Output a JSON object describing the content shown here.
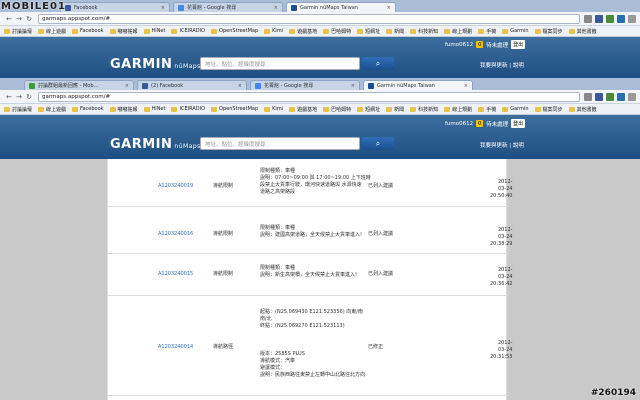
{
  "watermark": {
    "brand": "MOBILE01",
    "post_id": "#260194"
  },
  "browser_back": {
    "tabs": [
      {
        "label": "Facebook",
        "color": "#3b5998"
      },
      {
        "label": "花菁館 - Google 搜尋",
        "color": "#4285f4"
      },
      {
        "label": "Garmin nüMaps Taiwan",
        "color": "#1a4f8f"
      }
    ],
    "url": "garmaps.appspot.com/#",
    "bookmarks": [
      "討論論壇",
      "線上遊戲",
      "Facebook",
      "嘟嘟搖報",
      "HiNet",
      "ICEIRADIO",
      "OpenStreetMap",
      "Kimi",
      "遊戲基地",
      "巴哈姆特",
      "短網址",
      "新聞",
      "科技新知",
      "線上規劃",
      "手機",
      "Garmin",
      "檔案同步",
      "其他書籤"
    ]
  },
  "garmin_back": {
    "user": "fumo0612",
    "badge": "0",
    "signal": "待未處理",
    "logout": "登出",
    "logo": "GARMIN",
    "logo_sub": "nüMaps",
    "search_placeholder": "地址、點位、經緯度搜尋",
    "search_icon": "magnifier-icon",
    "links": "我要與更新 | 說明"
  },
  "browser_front": {
    "tabs": [
      {
        "label": "討論群組最新回應 - Mob…",
        "color": "#3a9d3a"
      },
      {
        "label": "(2) Facebook",
        "color": "#3b5998"
      },
      {
        "label": "花菁館 - Google 搜尋",
        "color": "#4285f4"
      },
      {
        "label": "Garmin nüMaps Taiwan",
        "color": "#1a4f8f"
      }
    ],
    "url": "garmaps.appspot.com/#",
    "bookmarks": [
      "討論論壇",
      "線上遊戲",
      "Facebook",
      "嘟嘟搖報",
      "HiNet",
      "ICEIRADIO",
      "OpenStreetMap",
      "Kimi",
      "遊戲基地",
      "巴哈姆特",
      "短網址",
      "新聞",
      "科技新知",
      "線上規劃",
      "手機",
      "Garmin",
      "檔案同步",
      "其他書籤"
    ]
  },
  "garmin_front": {
    "user": "fumo0612",
    "badge": "0",
    "signal": "待未處理",
    "logout": "登出",
    "logo": "GARMIN",
    "logo_sub": "nüMaps",
    "search_placeholder": "地址、點位、經緯度搜尋",
    "links": "我要與更新 | 說明"
  },
  "records": [
    {
      "id": "A1203240019",
      "type": "導航限制",
      "detail": [
        "限制種類：車種",
        "說明：07:00~09:00 與 17:00~19:00 上下班時",
        "段禁止大貨車行駛，環河快速道路與 水源快速",
        "道路之高架路段"
      ],
      "status": "已列入建議",
      "date": "2012-03-24",
      "time": "20:50:40"
    },
    {
      "id": "A1203240016",
      "type": "導航限制",
      "detail": [
        "限制種類：車種",
        "說明：建國高架道路，全天候禁止大貨車進入!"
      ],
      "status": "已列入建議",
      "date": "2012-03-24",
      "time": "20:38:29"
    },
    {
      "id": "A1203240015",
      "type": "導航限制",
      "detail": [
        "限制種類：車種",
        "說明：新生高架橋，全天候禁止大貨車進入!"
      ],
      "status": "已列入建議",
      "date": "2012-03-24",
      "time": "20:36:42"
    },
    {
      "id": "A1203240014",
      "type": "導航路徑",
      "detail": [
        "起點：(N25.069430 E121.523356) 向東/南",
        "南/北",
        "終點：(N25.069270 E121.523113)",
        "",
        "",
        "",
        "版本：2585S PLUS",
        "導航模式：汽車",
        "避讓模式：",
        "說明：民族西路往東禁止左轉中山北路往北方向"
      ],
      "status": "已修正",
      "date": "2012-03-24",
      "time": "20:31:53"
    }
  ]
}
